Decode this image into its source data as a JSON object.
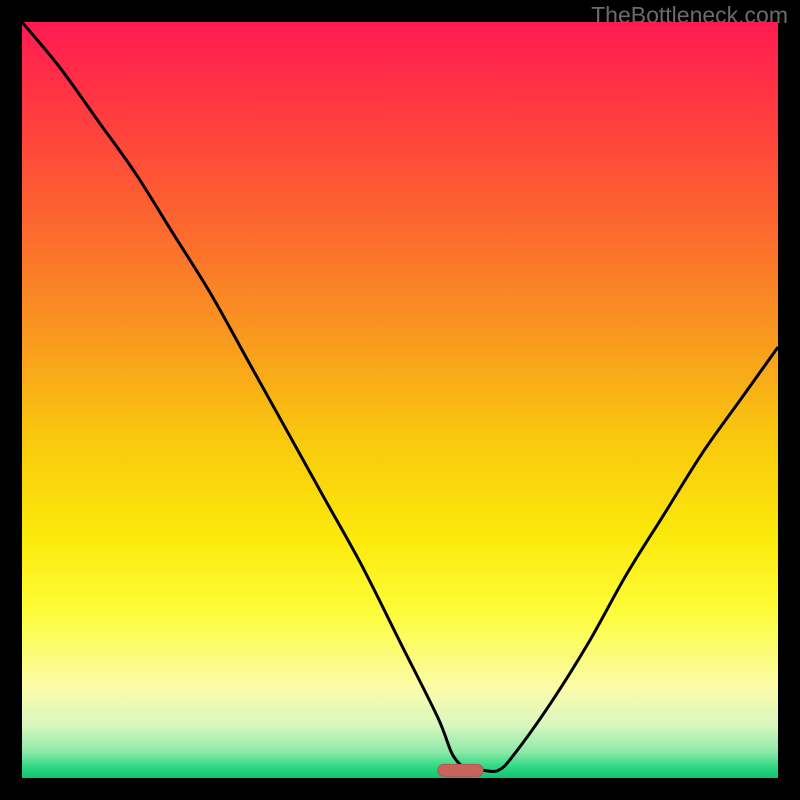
{
  "credit": "TheBottleneck.com",
  "chart_data": {
    "type": "line",
    "title": "",
    "xlabel": "",
    "ylabel": "",
    "xlim": [
      0,
      100
    ],
    "ylim": [
      0,
      100
    ],
    "x": [
      0,
      5,
      10,
      15,
      20,
      25,
      30,
      35,
      40,
      45,
      50,
      55,
      57,
      59,
      60,
      61,
      63,
      65,
      70,
      75,
      80,
      85,
      90,
      95,
      100
    ],
    "values": [
      100,
      94,
      87,
      80,
      72,
      64,
      55,
      46,
      37,
      28,
      18,
      8,
      3,
      1,
      1,
      1,
      1,
      3,
      10,
      18,
      27,
      35,
      43,
      50,
      57
    ],
    "marker": {
      "x_start": 55,
      "x_end": 61,
      "y": 1
    },
    "gradient_stops": [
      {
        "pos": 0.0,
        "color": "#ff1a52"
      },
      {
        "pos": 0.12,
        "color": "#ff3b3f"
      },
      {
        "pos": 0.28,
        "color": "#fc6b2e"
      },
      {
        "pos": 0.42,
        "color": "#f99a1e"
      },
      {
        "pos": 0.55,
        "color": "#f9c80e"
      },
      {
        "pos": 0.68,
        "color": "#fbe90a"
      },
      {
        "pos": 0.78,
        "color": "#fdfd3a"
      },
      {
        "pos": 0.88,
        "color": "#fcfca9"
      },
      {
        "pos": 0.93,
        "color": "#d9f7c0"
      },
      {
        "pos": 0.965,
        "color": "#8ee9a8"
      },
      {
        "pos": 0.985,
        "color": "#2fd884"
      },
      {
        "pos": 1.0,
        "color": "#12c36f"
      }
    ],
    "curve_color": "#000000",
    "marker_fill": "#c6635c",
    "marker_stroke": "#b6544e"
  }
}
